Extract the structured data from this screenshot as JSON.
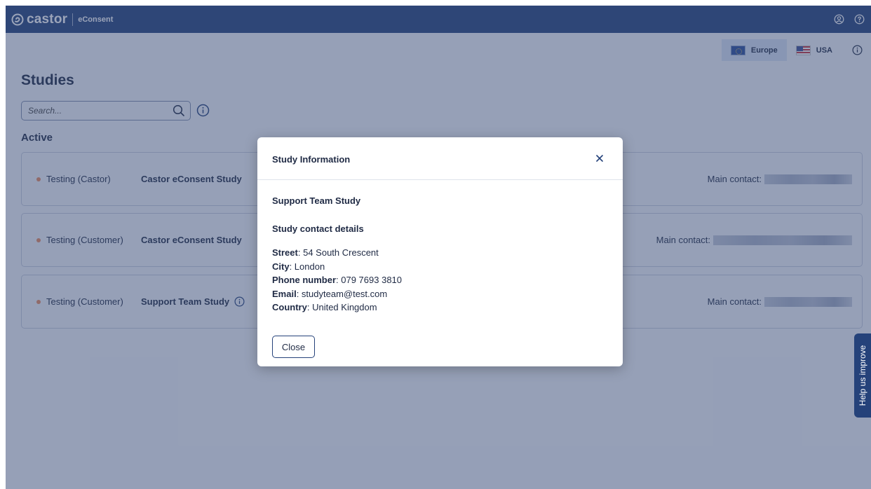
{
  "app": {
    "brand": "castor",
    "product": "eConsent"
  },
  "header_icons": [
    "user-circle-icon",
    "help-circle-icon"
  ],
  "region": {
    "options": [
      {
        "label": "Europe",
        "flag": "eu-flag-icon",
        "selected": true
      },
      {
        "label": "USA",
        "flag": "us-flag-icon",
        "selected": false
      }
    ]
  },
  "page": {
    "title": "Studies",
    "section": "Active"
  },
  "search": {
    "placeholder": "Search...",
    "value": ""
  },
  "studies": [
    {
      "status": "Testing (Castor)",
      "name": "Castor eConsent Study",
      "contact_label": "Main contact:"
    },
    {
      "status": "Testing (Customer)",
      "name": "Castor eConsent Study",
      "contact_label": "Main contact:"
    },
    {
      "status": "Testing (Customer)",
      "name": "Support Team Study",
      "contact_label": "Main contact:"
    }
  ],
  "help_tab": "Help us improve",
  "modal": {
    "title": "Study Information",
    "study_name": "Support Team Study",
    "contact_heading": "Study contact details",
    "street_label": "Street",
    "street": "54 South Crescent",
    "city_label": "City",
    "city": "London",
    "phone_label": "Phone number",
    "phone": "079 7693 3810",
    "email_label": "Email",
    "email": "studyteam@test.com",
    "country_label": "Country",
    "country": "United Kingdom",
    "close_label": "Close"
  },
  "colors": {
    "brand": "#25427a",
    "status_dot": "#e98a5e",
    "overlay": "#374973"
  }
}
